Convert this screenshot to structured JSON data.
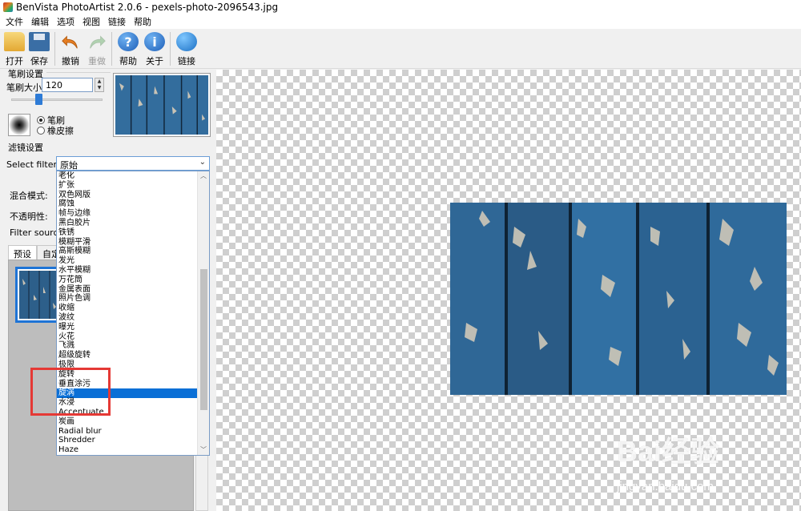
{
  "window": {
    "title": "BenVista PhotoArtist 2.0.6 - pexels-photo-2096543.jpg"
  },
  "menu": [
    "文件",
    "编辑",
    "选项",
    "视图",
    "链接",
    "帮助"
  ],
  "toolbar": {
    "open": "打开",
    "save": "保存",
    "undo": "撤销",
    "redo": "重做",
    "help": "帮助",
    "about": "关于",
    "link": "链接"
  },
  "brush": {
    "group_title": "笔刷设置",
    "size_label": "笔刷大小:",
    "size_value": "120",
    "slider_level_percent": 31,
    "mode_brush": "笔刷",
    "mode_eraser": "橡皮擦",
    "selected_mode": "笔刷"
  },
  "filter": {
    "group_title": "滤镜设置",
    "select_label": "Select filter:",
    "selected": "原始",
    "blend_label": "混合模式:",
    "opacity_label": "不透明性:",
    "source_label": "Filter source:",
    "list": [
      "老化",
      "扩张",
      "双色网版",
      "腐蚀",
      "帧与边缘",
      "黑白胶片",
      "铁锈",
      "模糊平滑",
      "高斯模糊",
      "发光",
      "水平模糊",
      "万花筒",
      "金属表面",
      "照片色调",
      "收缩",
      "波纹",
      "曝光",
      "火花",
      "飞溅",
      "超级旋转",
      "极限",
      "旋转",
      "垂直涂污",
      "旋涡",
      "水浸",
      "Accentuate",
      "炭画",
      "Radial blur",
      "Shredder",
      "Haze"
    ],
    "highlighted_index": 23
  },
  "tabs": {
    "preset": "预设",
    "custom": "自定"
  },
  "watermark": {
    "brand": "Bai",
    "brand_cn": "经验",
    "url": "jingyan.baidu.com"
  },
  "colors": {
    "accent": "#0a6fd6",
    "highlight_box": "#e53935",
    "wood_blue": "#2d5f8a"
  }
}
